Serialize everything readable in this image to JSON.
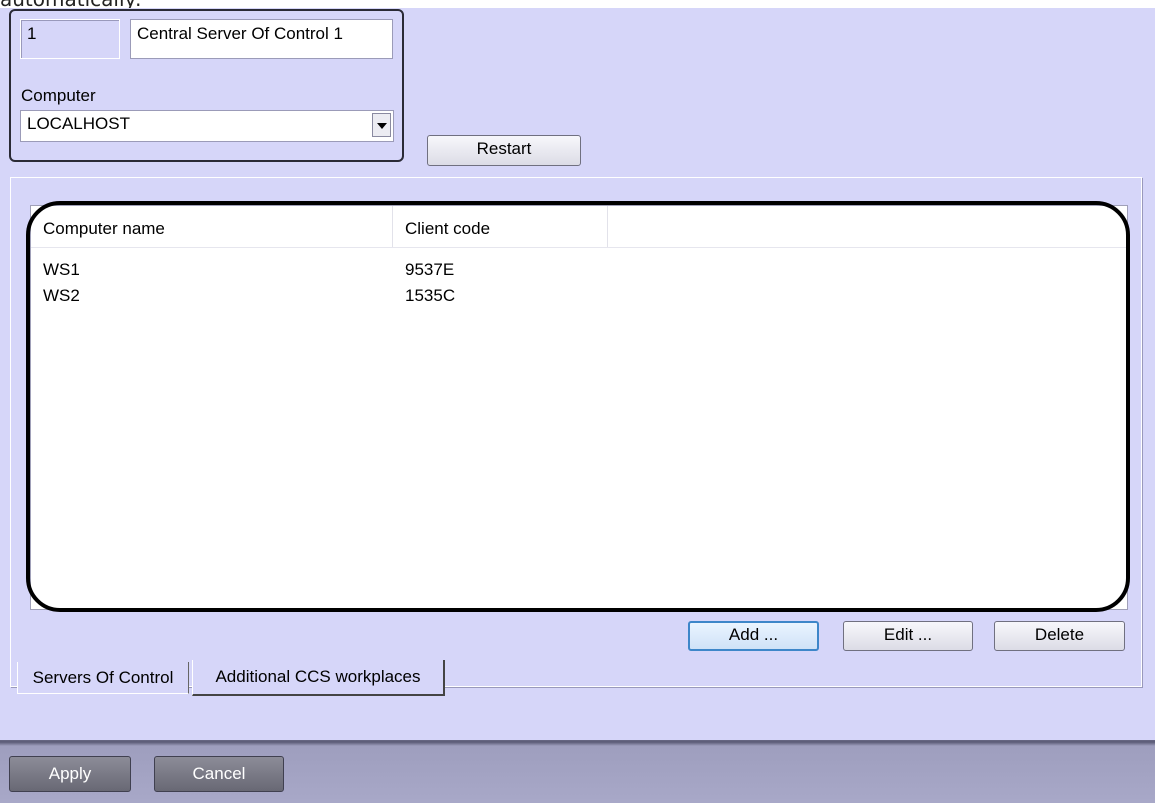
{
  "header_text": "automatically:",
  "server": {
    "id_value": "1",
    "name_value": "Central Server Of Control 1",
    "computer_label": "Computer",
    "computer_value": "LOCALHOST",
    "restart_label": "Restart"
  },
  "workplaces": {
    "columns": [
      "Computer name",
      "Client code"
    ],
    "rows": [
      {
        "computer_name": "WS1",
        "client_code": "9537E"
      },
      {
        "computer_name": "WS2",
        "client_code": "1535C"
      }
    ],
    "add_label": "Add ...",
    "edit_label": "Edit ...",
    "delete_label": "Delete"
  },
  "tabs": [
    {
      "label": "Servers Of Control",
      "active": false
    },
    {
      "label": "Additional CCS workplaces",
      "active": true
    }
  ],
  "footer": {
    "apply_label": "Apply",
    "cancel_label": "Cancel"
  },
  "colors": {
    "panel_bg": "#d6d6f9",
    "highlight": "#000000"
  }
}
